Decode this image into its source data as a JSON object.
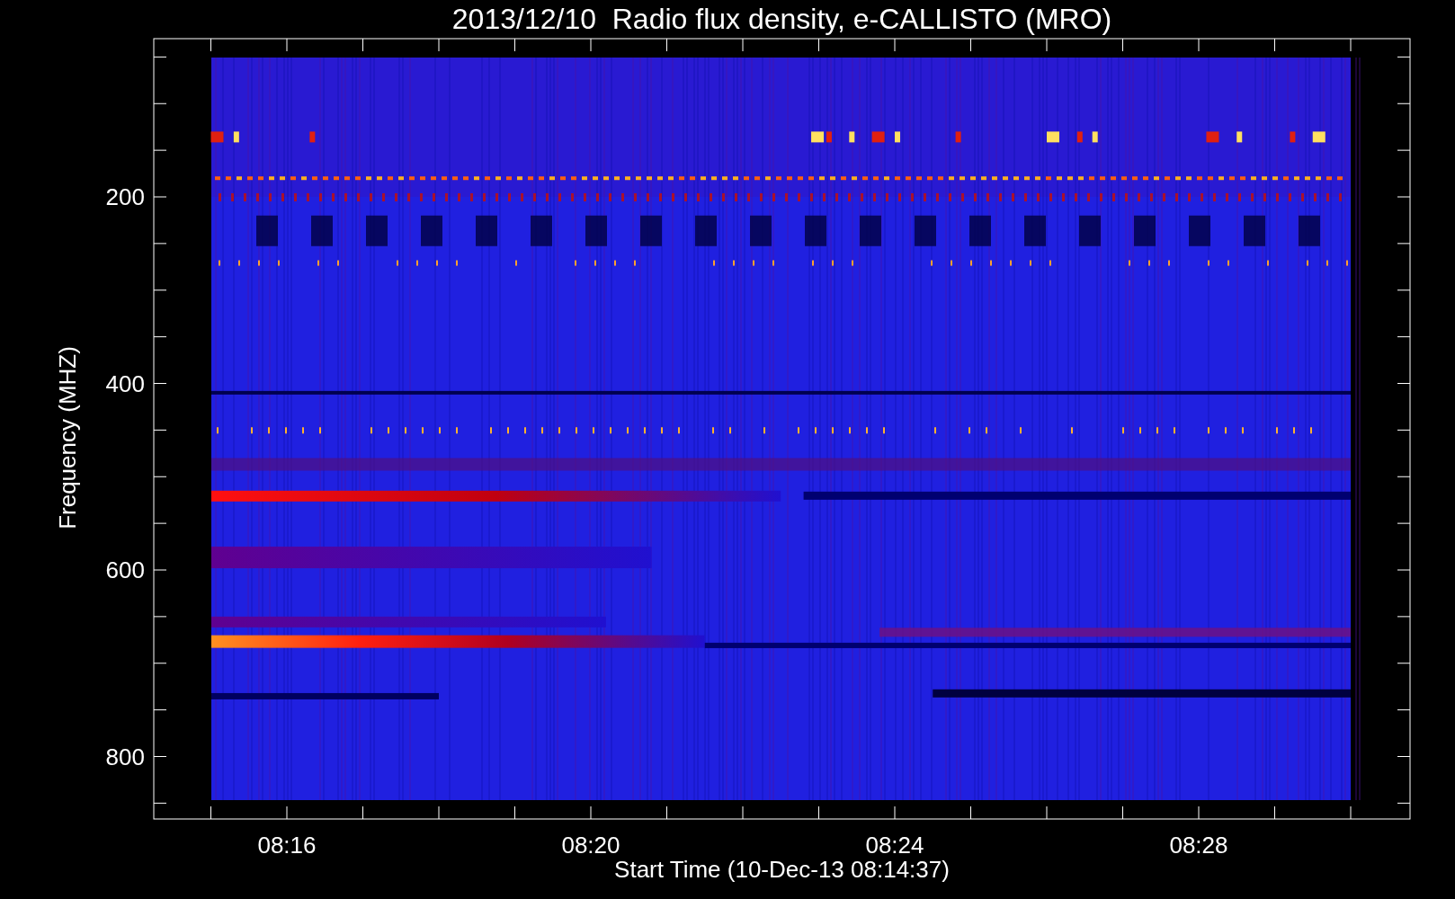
{
  "title": "2013/12/10  Radio flux density, e-CALLISTO (MRO)",
  "y_axis": {
    "label": "Frequency (MHZ)",
    "ticks": [
      "200",
      "400",
      "600",
      "800"
    ]
  },
  "x_axis": {
    "label": "Start Time (10-Dec-13 08:14:37)",
    "ticks": [
      "08:16",
      "08:20",
      "08:24",
      "08:28"
    ]
  }
}
